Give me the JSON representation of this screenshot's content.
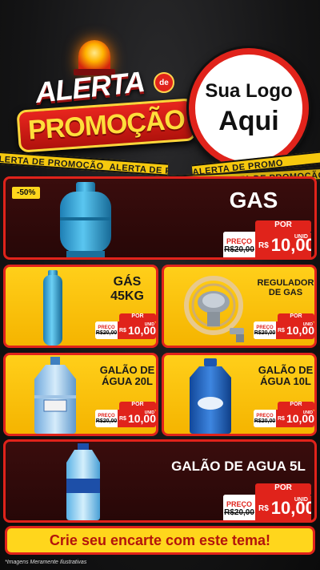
{
  "header": {
    "alerta": "ALERTA",
    "de": "de",
    "promocao": "PROMOÇÃO",
    "logo_line1": "Sua Logo",
    "logo_line2": "Aqui"
  },
  "tape_text": "ALERTA DE PROMOÇÃO",
  "tape_text_2": "ALERTA DE PROMO",
  "colors": {
    "accent_red": "#e0231b",
    "accent_yellow": "#ffd61c",
    "dark": "#270707"
  },
  "products": [
    {
      "title": "GAS",
      "discount": "-50%",
      "por": "POR",
      "preco": "PREÇO",
      "old": "R$20,00",
      "rs": "R$",
      "new": "10,00",
      "unid": "UNID",
      "icon": "gas-cylinder-icon"
    },
    {
      "title_l1": "GÁS",
      "title_l2": "45KG",
      "por": "POR",
      "preco": "PREÇO",
      "old": "R$20,00",
      "rs": "R$",
      "new": "10,00",
      "unid": "UNID",
      "icon": "tall-gas-cylinder-icon"
    },
    {
      "title_l1": "REGULADOR",
      "title_l2": "DE GAS",
      "por": "POR",
      "preco": "PREÇO",
      "old": "R$20,00",
      "rs": "R$",
      "new": "10,00",
      "unid": "UNID",
      "icon": "gas-regulator-icon"
    },
    {
      "title_l1": "GALÃO DE",
      "title_l2": "ÁGUA 20L",
      "por": "POR",
      "preco": "PREÇO",
      "old": "R$20,00",
      "rs": "R$",
      "new": "10,00",
      "unid": "UNID",
      "icon": "water-jug-20l-icon"
    },
    {
      "title_l1": "GALÃO DE",
      "title_l2": "ÁGUA 10L",
      "por": "POR",
      "preco": "PREÇO",
      "old": "R$20,00",
      "rs": "R$",
      "new": "10,00",
      "unid": "UNID",
      "icon": "water-jug-10l-icon"
    },
    {
      "title": "GALÃO DE AGUA 5L",
      "por": "POR",
      "preco": "PREÇO",
      "old": "R$20,00",
      "rs": "R$",
      "new": "10,00",
      "unid": "UNID",
      "icon": "water-bottle-5l-icon"
    }
  ],
  "footer": {
    "cta": "Crie seu encarte com este tema!",
    "disclaimer": "*Imagens Meramente Ilustrativas"
  }
}
